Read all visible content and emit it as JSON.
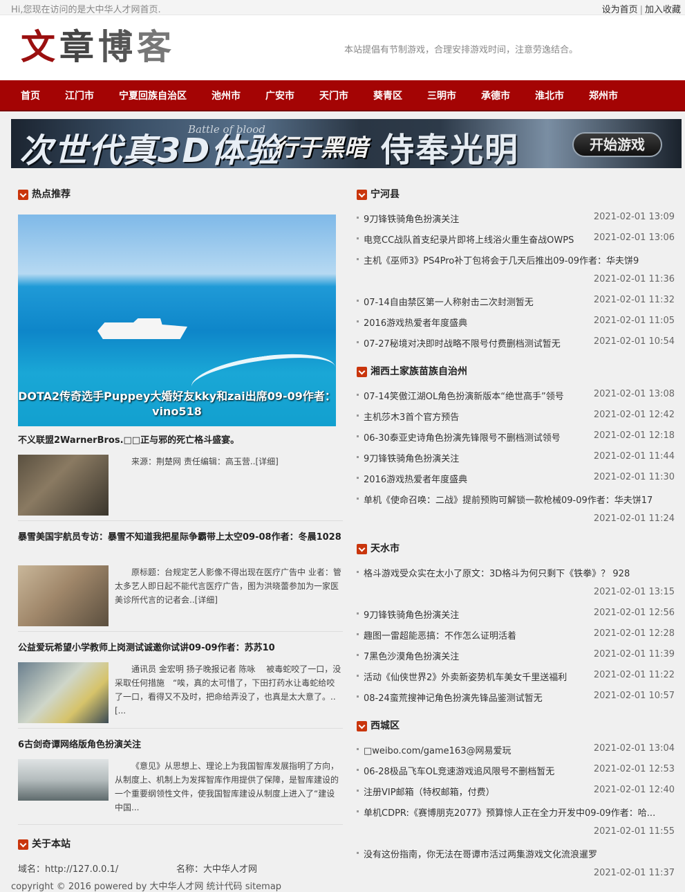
{
  "topbar": {
    "greeting": "Hi,您现在访问的是大中华人才网首页.",
    "set_home": "设为首页",
    "add_favorite": "加入收藏",
    "separator": "|"
  },
  "header": {
    "logo": [
      "文",
      "章",
      "博",
      "客"
    ],
    "slogan": "本站提倡有节制游戏，合理安排游戏时间，注意劳逸结合。"
  },
  "nav": [
    "首页",
    "江门市",
    "宁夏回族自治区",
    "池州市",
    "广安市",
    "天门市",
    "葵青区",
    "三明市",
    "承德市",
    "淮北市",
    "郑州市"
  ],
  "banner": {
    "left": "次世代真3D体验",
    "script": "Battle of blood",
    "middle": "行于黑暗",
    "right": "侍奉光明",
    "button": "开始游戏"
  },
  "hot": {
    "title": "热点推荐",
    "hero_caption": "DOTA2传奇选手Puppey大婚好友kky和zai出席09-09作者：vino518",
    "articles": [
      {
        "title": "不义联盟2WarnerBros.□□正与邪的死亡格斗盛宴。",
        "desc": "来源：荆楚网 责任编辑：高玉营..[详细]"
      },
      {
        "title": "暴雪美国宇航员专访：暴雪不知道我把星际争霸带上太空09-08作者：冬晨1028",
        "desc": "原标题：台规定艺人影像不得出现在医疗广告中 业者：管太多艺人即日起不能代言医疗广告，图为洪晓蕾参加为一家医美诊所代言的记者会..[详细]"
      },
      {
        "title": "公益爱玩希望小学教师上岗测试诚邀你试讲09-09作者：苏苏10",
        "desc": "通讯员 金宏明 扬子晚报记者 陈咏 　被毒蛇咬了一口，没采取任何措施　“唉，真的太可惜了，下田打药水让毒蛇给咬了一口，看得又不及时，把命给弄没了，也真是太大意了。..[..."
      },
      {
        "title": "6古剑奇谭网络版角色扮演关注",
        "desc": "《意见》从思想上、理论上为我国智库发展指明了方向，从制度上、机制上为发挥智库作用提供了保障，是智库建设的一个重要纲领性文件，使我国智库建设从制度上进入了“建设中国..."
      }
    ]
  },
  "about": {
    "title": "关于本站",
    "domain_label": "域名：http://127.0.0.1/",
    "name_label": "名称：大中华人才网"
  },
  "footer": "copyright © 2016 powered by 大中华人才网  统计代码 sitemap",
  "sections": [
    {
      "title": "宁河县",
      "items": [
        {
          "text": "9刀锋铁骑角色扮演关注",
          "date": "2021-02-01 13:09"
        },
        {
          "text": "电竞CC战队首支纪录片即将上线浴火重生奋战OWPS",
          "date": "2021-02-01 13:06"
        },
        {
          "text": "主机《巫师3》PS4Pro补丁包将会于几天后推出09-09作者：华夫饼9",
          "date": "2021-02-01 11:36"
        },
        {
          "text": "07-14自由禁区第一人称射击二次封测暂无",
          "date": "2021-02-01 11:32"
        },
        {
          "text": "2016游戏热爱者年度盛典",
          "date": "2021-02-01 11:05"
        },
        {
          "text": "07-27秘境对决即时战略不限号付费删档测试暂无",
          "date": "2021-02-01 10:54"
        }
      ]
    },
    {
      "title": "湘西土家族苗族自治州",
      "items": [
        {
          "text": "07-14笑傲江湖OL角色扮演新版本“绝世高手”领号",
          "date": "2021-02-01 13:08"
        },
        {
          "text": "主机莎木3首个官方预告",
          "date": "2021-02-01 12:42"
        },
        {
          "text": "06-30泰亚史诗角色扮演先锋限号不删档测试领号",
          "date": "2021-02-01 12:18"
        },
        {
          "text": "9刀锋铁骑角色扮演关注",
          "date": "2021-02-01 11:44"
        },
        {
          "text": "2016游戏热爱者年度盛典",
          "date": "2021-02-01 11:30"
        },
        {
          "text": "单机《使命召唤：二战》提前预购可解锁一款枪械09-09作者：华夫饼17",
          "date": "2021-02-01 11:24"
        }
      ]
    },
    {
      "title": "天水市",
      "items": [
        {
          "text": "格斗游戏受众实在太小了原文：3D格斗为何只剩下《铁拳》？ 928",
          "date": "2021-02-01 13:15"
        },
        {
          "text": "9刀锋铁骑角色扮演关注",
          "date": "2021-02-01 12:56"
        },
        {
          "text": "趣图一雷超能恶搞：不作怎么证明活着",
          "date": "2021-02-01 12:28"
        },
        {
          "text": "7黑色沙漠角色扮演关注",
          "date": "2021-02-01 11:39"
        },
        {
          "text": "活动《仙侠世界2》外卖新姿势机车美女千里送福利",
          "date": "2021-02-01 11:22"
        },
        {
          "text": "08-24蛮荒搜神记角色扮演先锋品鉴测试暂无",
          "date": "2021-02-01 10:57"
        }
      ]
    },
    {
      "title": "西城区",
      "items": [
        {
          "text": "□weibo.com/game163@网易爱玩",
          "date": "2021-02-01 13:04"
        },
        {
          "text": "06-28极品飞车OL竞速游戏追风限号不删档暂无",
          "date": "2021-02-01 12:53"
        },
        {
          "text": "注册VIP邮箱（特权邮箱，付费）",
          "date": "2021-02-01 12:40"
        },
        {
          "text": "单机CDPR:《赛博朋克2077》预算惊人正在全力开发中09-09作者：哈...",
          "date": "2021-02-01 11:55"
        },
        {
          "text": "没有这份指南，你无法在哥谭市活过两集游戏文化流浪暹罗",
          "date": "2021-02-01 11:37"
        }
      ]
    }
  ]
}
